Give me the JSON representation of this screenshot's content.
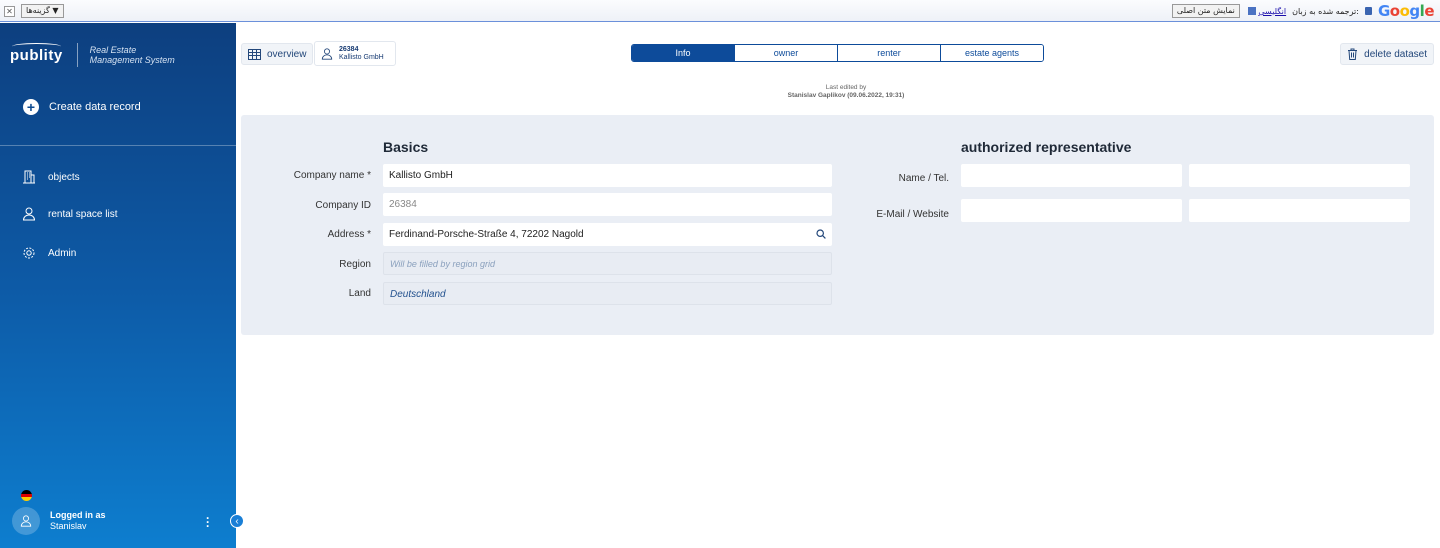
{
  "translate_bar": {
    "options_label": "گزینه‌ها ▼",
    "translated_label": "ترجمه شده به زبان:",
    "language": "انگلیسی",
    "show_original": "نمایش متن اصلی",
    "google": "Google",
    "google_colors": [
      "#4285f4",
      "#ea4335",
      "#fbbc05",
      "#4285f4",
      "#34a853",
      "#ea4335"
    ]
  },
  "sidebar": {
    "brand": "publity",
    "brand_sub_1": "Real Estate",
    "brand_sub_2": "Management System",
    "create": "Create data record",
    "items": [
      {
        "label": "objects",
        "icon": "building-icon"
      },
      {
        "label": "rental space list",
        "icon": "person-icon"
      },
      {
        "label": "Admin",
        "icon": "gear-icon"
      }
    ],
    "logged_in_as": "Logged in as",
    "user_name": "Stanislav",
    "flag_colors": [
      "#000000",
      "#dd0000",
      "#ffce00"
    ]
  },
  "toolbar": {
    "overview": "overview",
    "record_id": "26384",
    "record_name": "Kallisto GmbH",
    "tabs": [
      "Info",
      "owner",
      "renter",
      "estate agents"
    ],
    "active_tab": "Info",
    "delete": "delete dataset"
  },
  "last_edit": {
    "line1": "Last edited by",
    "line2": "Stanislav Gaplikov (09.06.2022, 19:31)"
  },
  "basics": {
    "title": "Basics",
    "company_name_label": "Company name *",
    "company_name": "Kallisto GmbH",
    "company_id_label": "Company ID",
    "company_id": "26384",
    "address_label": "Address *",
    "address": "Ferdinand-Porsche-Straße 4, 72202 Nagold",
    "region_label": "Region",
    "region_placeholder": "Will be filled by region grid",
    "land_label": "Land",
    "land": "Deutschland"
  },
  "representative": {
    "title": "authorized representative",
    "name_tel_label": "Name / Tel.",
    "email_web_label": "E-Mail / Website"
  },
  "colors": {
    "accent": "#0d4b9a",
    "card_bg": "#eaeef5"
  }
}
